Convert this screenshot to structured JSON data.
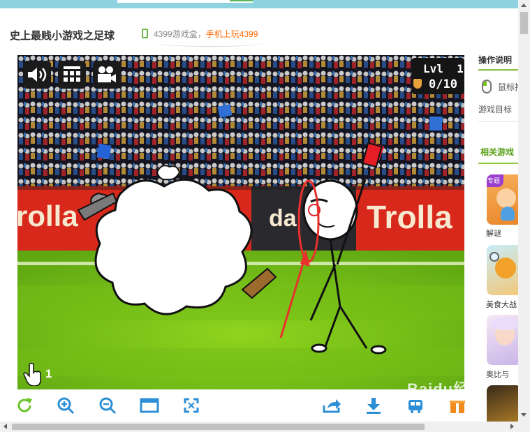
{
  "header": {
    "title": "史上最贱小游戏之足球",
    "promo_prefix": "4399游戏盒，",
    "promo_link": "手机上玩4399"
  },
  "game": {
    "level_label": "Lvl  1",
    "progress": "0/10",
    "hand_count": "1",
    "banner_left": "rolla",
    "banner_mid": "da",
    "banner_right": "Trolla",
    "colors": {
      "pitch": "#7cc418",
      "banner": "#d8281c",
      "crowd": "#141420"
    }
  },
  "toolbar": {
    "items": [
      "refresh-icon",
      "zoom-in-icon",
      "zoom-out-icon",
      "window-icon",
      "fullscreen-icon",
      "share-icon",
      "download-icon"
    ],
    "accent": "#2d8fd5"
  },
  "sidebar": {
    "section_ops": "操作说明",
    "mouse_text": "鼠标拖",
    "goal_text": "游戏目标",
    "related": "相关游戏",
    "games": [
      {
        "label": "解谜",
        "badge": "专题"
      },
      {
        "label": "美食大战"
      },
      {
        "label": "奥比与"
      }
    ]
  },
  "watermark": "Baidu经验"
}
